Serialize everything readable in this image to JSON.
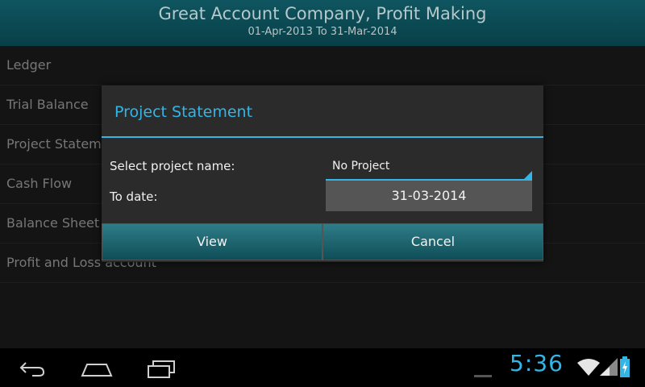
{
  "header": {
    "title": "Great Account Company, Profit Making",
    "subtitle": "01-Apr-2013 To 31-Mar-2014"
  },
  "list": {
    "items": [
      {
        "label": "Ledger"
      },
      {
        "label": "Trial Balance"
      },
      {
        "label": "Project Statem"
      },
      {
        "label": "Cash Flow"
      },
      {
        "label": "Balance Sheet"
      },
      {
        "label": "Profit and Loss account"
      }
    ]
  },
  "dialog": {
    "title": "Project Statement",
    "project_label": "Select project name:",
    "project_value": "No Project",
    "date_label": "To date:",
    "date_value": "31-03-2014",
    "view_label": "View",
    "cancel_label": "Cancel"
  },
  "statusbar": {
    "time": "5:36"
  },
  "colors": {
    "accent": "#33b5e5",
    "header_bg": "#0f5560"
  }
}
